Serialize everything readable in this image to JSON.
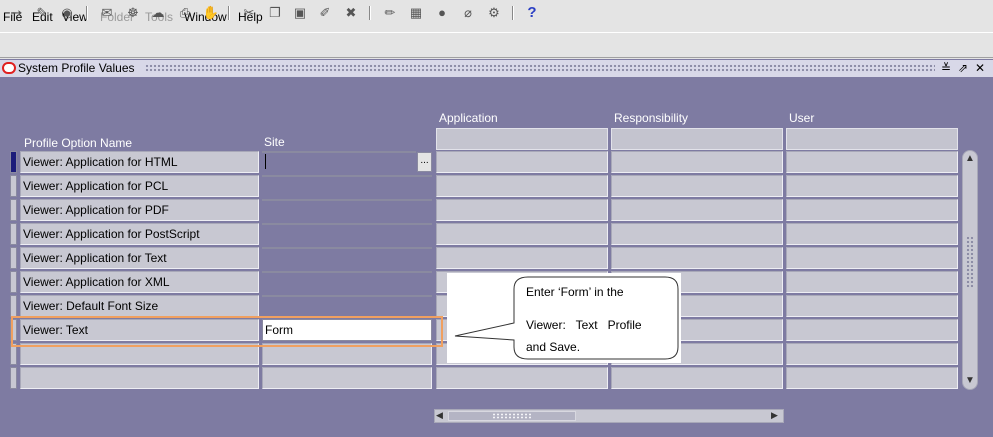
{
  "menu": [
    "File",
    "Edit",
    "View",
    "Folder",
    "Tools",
    "Window",
    "Help"
  ],
  "window": {
    "title": "System Profile Values",
    "controls": [
      "≚",
      "⇗",
      "✕"
    ]
  },
  "columns": {
    "profile_option_name": "Profile Option Name",
    "site": "Site",
    "application": "Application",
    "responsibility": "Responsibility",
    "user": "User"
  },
  "rows": [
    {
      "name": "Viewer: Application for HTML",
      "site": ""
    },
    {
      "name": "Viewer: Application for PCL",
      "site": ""
    },
    {
      "name": "Viewer: Application for PDF",
      "site": ""
    },
    {
      "name": "Viewer: Application for PostScript",
      "site": ""
    },
    {
      "name": "Viewer: Application for Text",
      "site": ""
    },
    {
      "name": "Viewer: Application for XML",
      "site": ""
    },
    {
      "name": "Viewer: Default Font Size",
      "site": ""
    },
    {
      "name": "Viewer: Text",
      "site": "Form"
    },
    {
      "name": "",
      "site": ""
    },
    {
      "name": "",
      "site": ""
    }
  ],
  "lov_button": "...",
  "callout": {
    "line1": "Enter ‘Form’ in the",
    "line2": "Viewer:   Text   Profile",
    "line3": "and Save."
  },
  "colors": {
    "workspace": "#7e7ba2",
    "highlight": "#f0a060",
    "current_record": "#1c1c7a"
  }
}
